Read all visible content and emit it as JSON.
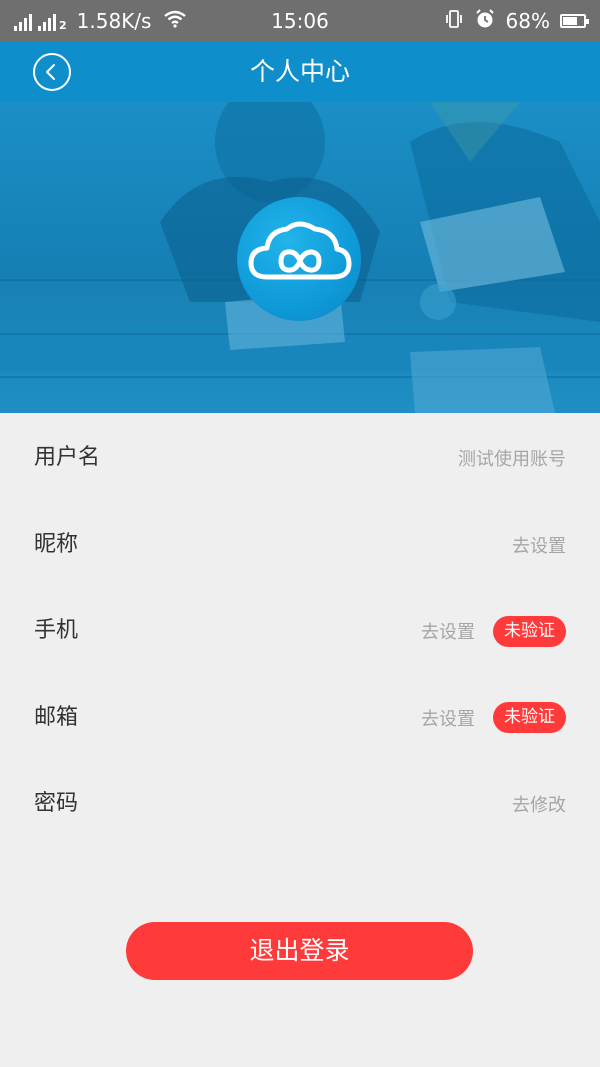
{
  "status_bar": {
    "network_label_1": "4G",
    "network_label_2": "2",
    "speed": "1.58K/s",
    "time": "15:06",
    "battery_percent": "68%",
    "battery_level": 0.68,
    "icons": [
      "signal-icon",
      "signal-icon",
      "wifi-icon",
      "vibrate-icon",
      "alarm-icon",
      "battery-icon"
    ]
  },
  "header": {
    "title": "个人中心",
    "back_icon": "back-icon",
    "color": "#0e8fcc"
  },
  "banner": {
    "logo_icon": "cloud-infinity-logo"
  },
  "profile": {
    "rows": [
      {
        "label": "用户名",
        "value": "测试使用账号"
      },
      {
        "label": "昵称",
        "value": "去设置"
      },
      {
        "label": "手机",
        "value": "去设置",
        "badge": "未验证"
      },
      {
        "label": "邮箱",
        "value": "去设置",
        "badge": "未验证"
      },
      {
        "label": "密码",
        "value": "去修改"
      }
    ]
  },
  "logout": {
    "label": "退出登录",
    "color": "#ff3a3a"
  }
}
